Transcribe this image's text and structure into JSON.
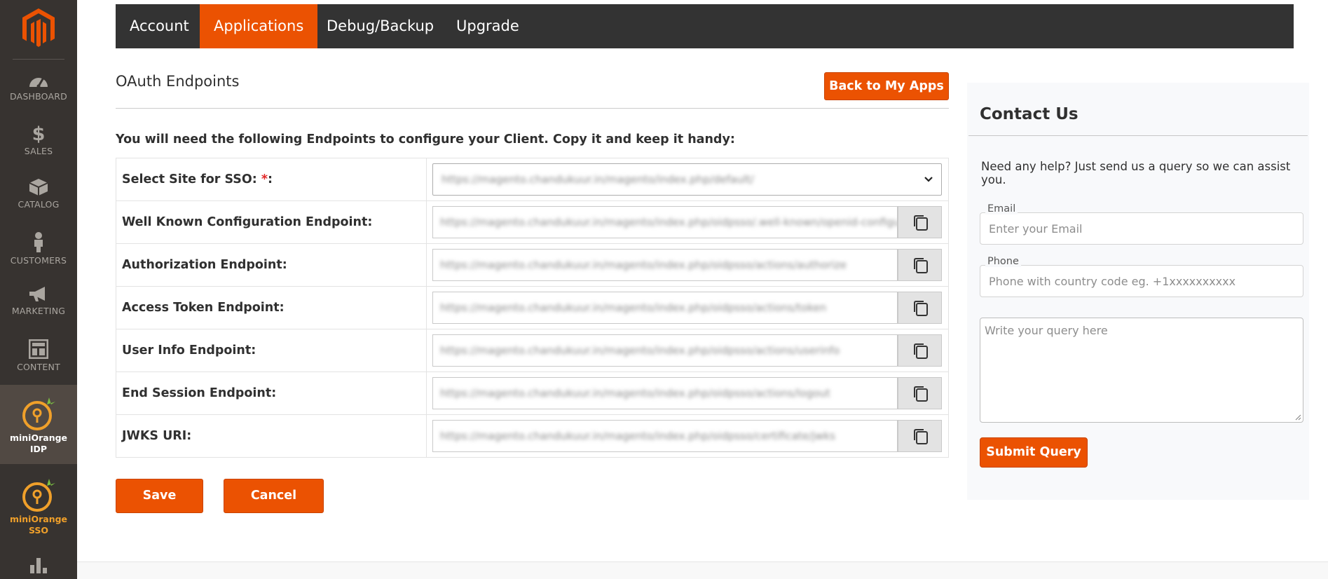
{
  "sidebar": {
    "items": [
      {
        "label": "DASHBOARD",
        "icon": "dashboard-icon"
      },
      {
        "label": "SALES",
        "icon": "dollar-icon"
      },
      {
        "label": "CATALOG",
        "icon": "box-icon"
      },
      {
        "label": "CUSTOMERS",
        "icon": "person-icon"
      },
      {
        "label": "MARKETING",
        "icon": "megaphone-icon"
      },
      {
        "label": "CONTENT",
        "icon": "layout-icon"
      }
    ],
    "plugins": [
      {
        "line1": "miniOrange",
        "line2": "IDP",
        "color": "#ffffff"
      },
      {
        "line1": "miniOrange",
        "line2": "SSO",
        "color": "#f0a02a"
      }
    ]
  },
  "tabs": [
    {
      "label": "Account"
    },
    {
      "label": "Applications"
    },
    {
      "label": "Debug/Backup"
    },
    {
      "label": "Upgrade"
    }
  ],
  "main": {
    "title": "OAuth Endpoints",
    "back_label": "Back to My Apps",
    "intro": "You will need the following Endpoints to configure your Client. Copy it and keep it handy:",
    "select_label": "Select Site for SSO:",
    "select_required": "*",
    "select_suffix": ":",
    "select_value": "https://magento.chandukuur.in/magento/index.php/default/",
    "endpoints": [
      {
        "label": "Well Known Configuration Endpoint:",
        "value": "https://magento.chandukuur.in/magento/index.php/oidpsso/.well-known/openid-configuration"
      },
      {
        "label": "Authorization Endpoint:",
        "value": "https://magento.chandukuur.in/magento/index.php/oidpsso/actions/authorize"
      },
      {
        "label": "Access Token Endpoint:",
        "value": "https://magento.chandukuur.in/magento/index.php/oidpsso/actions/token"
      },
      {
        "label": "User Info Endpoint:",
        "value": "https://magento.chandukuur.in/magento/index.php/oidpsso/actions/userinfo"
      },
      {
        "label": "End Session Endpoint:",
        "value": "https://magento.chandukuur.in/magento/index.php/oidpsso/actions/logout"
      },
      {
        "label": "JWKS URI:",
        "value": "https://magento.chandukuur.in/magento/index.php/oidpsso/certificate/jwks"
      }
    ],
    "save_label": "Save",
    "cancel_label": "Cancel"
  },
  "contact": {
    "title": "Contact Us",
    "help": "Need any help? Just send us a query so we can assist you.",
    "email_label": "Email",
    "email_placeholder": "Enter your Email",
    "phone_label": "Phone",
    "phone_placeholder": "Phone with country code eg. +1xxxxxxxxxx",
    "query_placeholder": "Write your query here",
    "submit_label": "Submit Query"
  },
  "colors": {
    "accent": "#eb5202",
    "sidebar": "#373330",
    "topnav": "#333333"
  }
}
